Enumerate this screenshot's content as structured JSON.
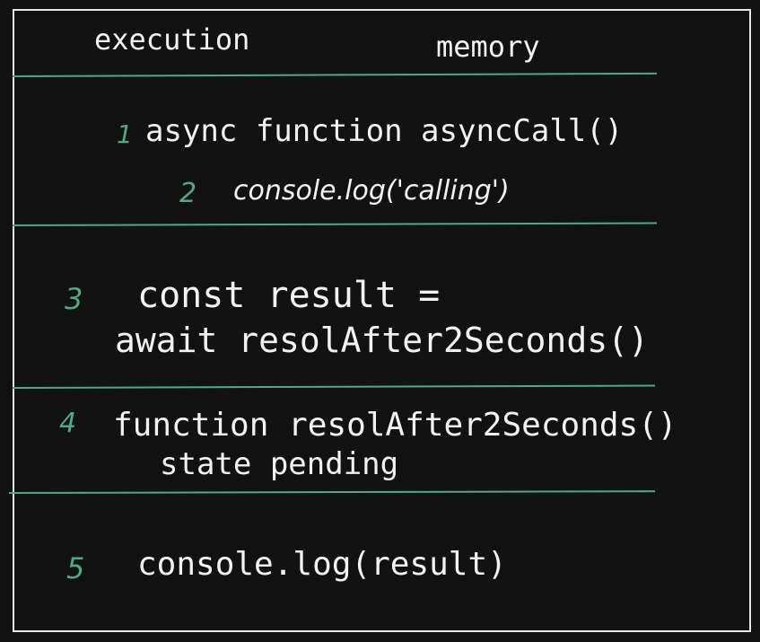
{
  "colors": {
    "background": "#121212",
    "text": "#f2f2f2",
    "accent": "#4fa987",
    "border": "#e8e8e8"
  },
  "headers": {
    "execution": "execution",
    "memory": "memory"
  },
  "steps": [
    {
      "number": "1",
      "text": "async function asyncCall()"
    },
    {
      "number": "2",
      "text": "console.log('calling')"
    },
    {
      "number": "3",
      "line1": "const result =",
      "line2": "await resolAfter2Seconds()"
    },
    {
      "number": "4",
      "line1": "function resolAfter2Seconds()",
      "line2": "state pending"
    },
    {
      "number": "5",
      "text": "console.log(result)"
    }
  ]
}
